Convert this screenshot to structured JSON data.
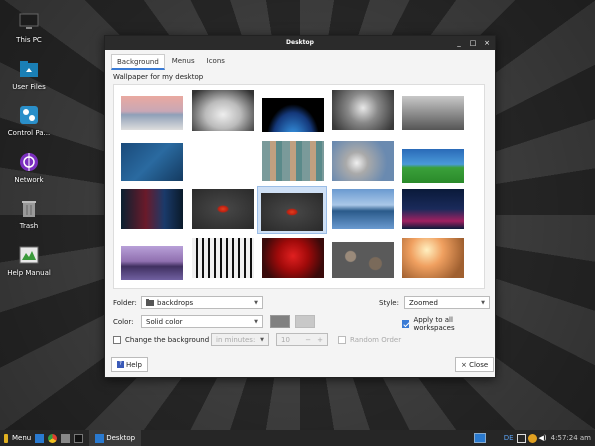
{
  "desktop": {
    "icons": [
      {
        "label": "This PC",
        "icon": "computer-icon"
      },
      {
        "label": "User Files",
        "icon": "folder-icon"
      },
      {
        "label": "Control Pa...",
        "icon": "control-panel-icon"
      },
      {
        "label": "Network",
        "icon": "network-icon"
      },
      {
        "label": "Trash",
        "icon": "trash-icon"
      },
      {
        "label": "Help Manual",
        "icon": "help-manual-icon"
      }
    ]
  },
  "dialog": {
    "title": "Desktop",
    "controls": {
      "minimize": "_",
      "maximize": "□",
      "close": "×"
    },
    "tabs": [
      "Background",
      "Menus",
      "Icons"
    ],
    "active_tab": "Background",
    "wallpaper_label": "Wallpaper for my desktop",
    "folder_label": "Folder:",
    "folder_value": "backdrops",
    "style_label": "Style:",
    "style_value": "Zoomed",
    "color_label": "Color:",
    "color_value": "Solid color",
    "swatch_colors": [
      "#808080",
      "#c8c8c8"
    ],
    "apply_all_label": "Apply to all workspaces",
    "apply_all_checked": true,
    "change_bg_label": "Change the background",
    "change_bg_checked": false,
    "interval_value": "in minutes:",
    "spin_value": "10",
    "spin_minus": "−",
    "spin_plus": "+",
    "random_label": "Random Order",
    "help_label": "Help",
    "close_label": "× Close"
  },
  "taskbar": {
    "menu_label": "Menu",
    "task_label": "Desktop",
    "lang": "DE",
    "clock": "4:57:24 am"
  },
  "colors": {
    "accent": "#3a7bd5",
    "titlebar": "#2b2b2b",
    "taskbar": "#262626"
  }
}
